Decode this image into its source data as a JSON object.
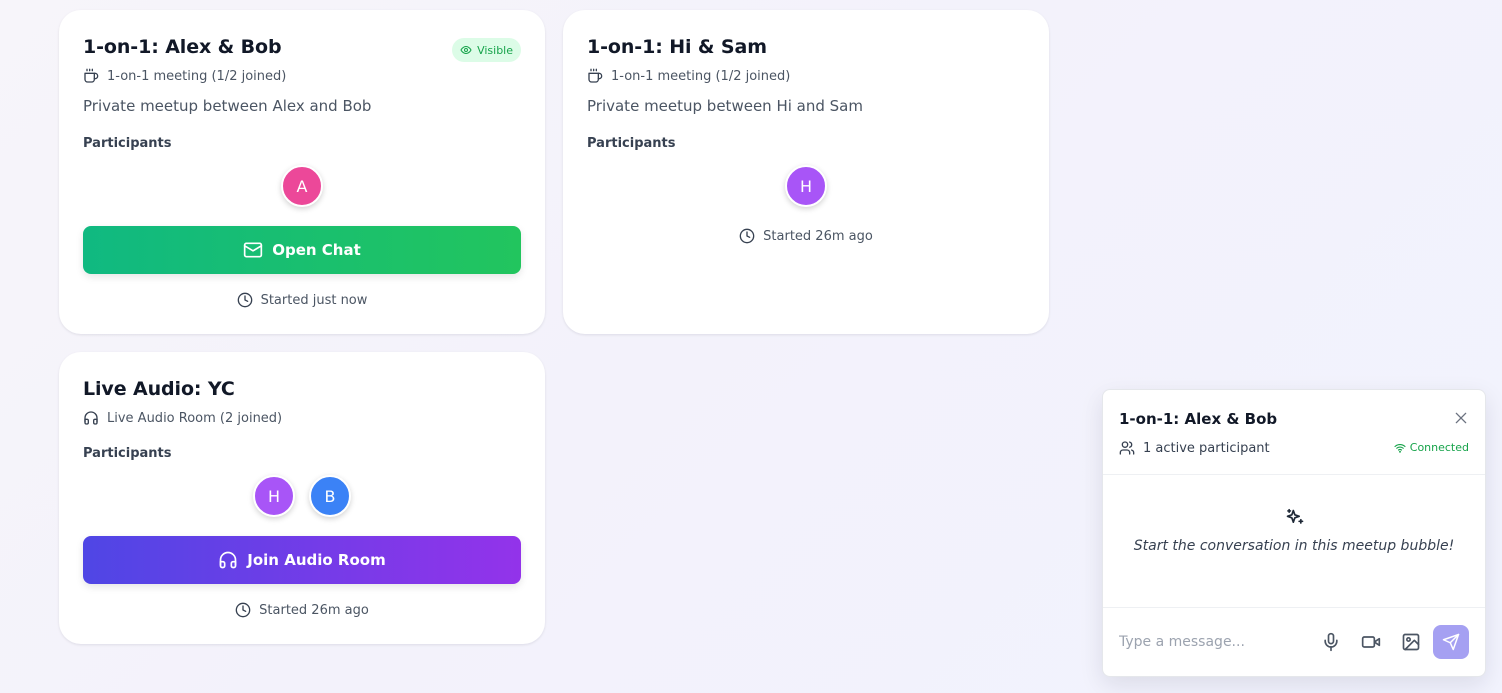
{
  "cards": [
    {
      "title": "1-on-1: Alex & Bob",
      "badge": "Visible",
      "meta": "1-on-1 meeting (1/2 joined)",
      "description": "Private meetup between Alex and Bob",
      "participants_label": "Participants",
      "participants": [
        {
          "initial": "A",
          "color": "#ec4899"
        }
      ],
      "button_label": "Open Chat",
      "started": "Started just now"
    },
    {
      "title": "1-on-1: Hi & Sam",
      "meta": "1-on-1 meeting (1/2 joined)",
      "description": "Private meetup between Hi and Sam",
      "participants_label": "Participants",
      "participants": [
        {
          "initial": "H",
          "color": "#a855f7"
        }
      ],
      "started": "Started 26m ago"
    },
    {
      "title": "Live Audio: YC",
      "meta": "Live Audio Room (2 joined)",
      "participants_label": "Participants",
      "participants": [
        {
          "initial": "H",
          "color": "#a855f7"
        },
        {
          "initial": "B",
          "color": "#3b82f6"
        }
      ],
      "button_label": "Join Audio Room",
      "started": "Started 26m ago"
    }
  ],
  "chat": {
    "title": "1-on-1: Alex & Bob",
    "participants_text": "1 active participant",
    "status": "Connected",
    "empty_message": "Start the conversation in this meetup bubble!",
    "input_placeholder": "Type a message..."
  },
  "colors": {
    "open_chat_gradient": [
      "#10b981",
      "#22c55e"
    ],
    "join_audio_gradient": [
      "#4f46e5",
      "#9333ea"
    ],
    "send_button": "#a5a0f2",
    "status_green": "#16a34a"
  },
  "icons": {
    "meeting": "coffee-cup-icon",
    "audio": "headphones-icon",
    "visible": "eye-icon",
    "chat": "mail-icon",
    "clock": "clock-icon",
    "users": "users-icon",
    "connected": "wifi-icon",
    "empty": "sparkles-icon",
    "mic": "mic-icon",
    "video": "video-icon",
    "image": "image-icon",
    "send": "send-icon",
    "close": "close-icon"
  }
}
